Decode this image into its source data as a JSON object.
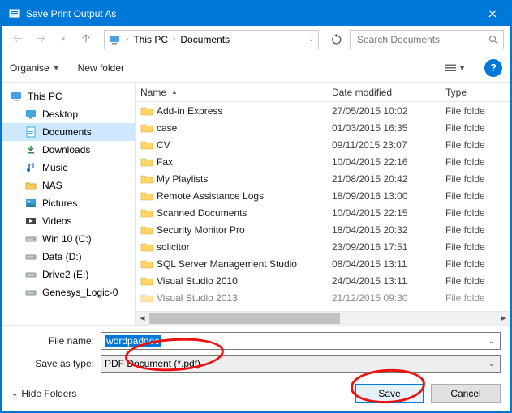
{
  "window": {
    "title": "Save Print Output As"
  },
  "nav": {
    "breadcrumb": [
      "This PC",
      "Documents"
    ],
    "search_placeholder": "Search Documents"
  },
  "toolbar": {
    "organise_label": "Organise",
    "newfolder_label": "New folder"
  },
  "tree": {
    "root": "This PC",
    "items": [
      {
        "label": "Desktop",
        "icon": "desktop"
      },
      {
        "label": "Documents",
        "icon": "documents",
        "selected": true
      },
      {
        "label": "Downloads",
        "icon": "downloads"
      },
      {
        "label": "Music",
        "icon": "music"
      },
      {
        "label": "NAS",
        "icon": "folder"
      },
      {
        "label": "Pictures",
        "icon": "pictures"
      },
      {
        "label": "Videos",
        "icon": "videos"
      },
      {
        "label": "Win 10 (C:)",
        "icon": "drive"
      },
      {
        "label": "Data (D:)",
        "icon": "drive"
      },
      {
        "label": "Drive2 (E:)",
        "icon": "drive"
      },
      {
        "label": "Genesys_Logic-0",
        "icon": "drive"
      }
    ]
  },
  "columns": {
    "name": "Name",
    "date": "Date modified",
    "type": "Type"
  },
  "files": [
    {
      "name": "Add-in Express",
      "date": "27/05/2015 10:02",
      "type": "File folde"
    },
    {
      "name": "case",
      "date": "01/03/2015 16:35",
      "type": "File folde"
    },
    {
      "name": "CV",
      "date": "09/11/2015 23:07",
      "type": "File folde"
    },
    {
      "name": "Fax",
      "date": "10/04/2015 22:16",
      "type": "File folde"
    },
    {
      "name": "My Playlists",
      "date": "21/08/2015 20:42",
      "type": "File folde"
    },
    {
      "name": "Remote Assistance Logs",
      "date": "18/09/2016 13:00",
      "type": "File folde"
    },
    {
      "name": "Scanned Documents",
      "date": "10/04/2015 22:15",
      "type": "File folde"
    },
    {
      "name": "Security Monitor Pro",
      "date": "18/04/2015 20:32",
      "type": "File folde"
    },
    {
      "name": "solicitor",
      "date": "23/09/2016 17:51",
      "type": "File folde"
    },
    {
      "name": "SQL Server Management Studio",
      "date": "08/04/2015 13:11",
      "type": "File folde"
    },
    {
      "name": "Visual Studio 2010",
      "date": "24/04/2015 13:11",
      "type": "File folde"
    },
    {
      "name": "Visual Studio 2013",
      "date": "21/12/2015 09:30",
      "type": "File folde"
    }
  ],
  "footer": {
    "filename_label": "File name:",
    "filename_value": "wordpaddoc",
    "saveastype_label": "Save as type:",
    "saveastype_value": "PDF Document (*.pdf)",
    "hide_label": "Hide Folders",
    "save_label": "Save",
    "cancel_label": "Cancel"
  }
}
